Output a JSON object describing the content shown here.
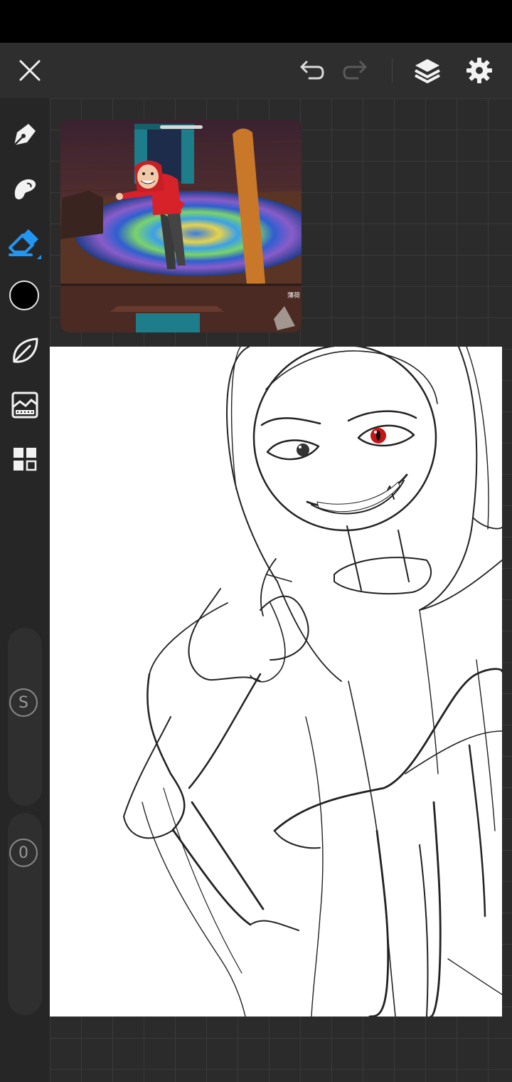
{
  "app": {
    "status_bar_color": "#000000",
    "accent_color": "#2196f3"
  },
  "toolbar": {
    "close_icon": "close-icon",
    "undo_icon": "undo-icon",
    "redo_icon": "redo-icon",
    "layers_icon": "layers-icon",
    "settings_icon": "gear-icon"
  },
  "tools": {
    "items": [
      {
        "name": "brush",
        "icon": "pen-nib-icon"
      },
      {
        "name": "smudge",
        "icon": "smudge-icon"
      },
      {
        "name": "eraser",
        "icon": "eraser-icon",
        "active": true
      },
      {
        "name": "color",
        "icon": "color-swatch",
        "value": "#000000"
      },
      {
        "name": "leaf",
        "icon": "leaf-icon"
      },
      {
        "name": "image-adjust",
        "icon": "image-icon"
      },
      {
        "name": "gallery",
        "icon": "grid-icon"
      }
    ]
  },
  "sliders": {
    "size_label": "S",
    "opacity_label": "0"
  },
  "reference": {
    "caption": "薄荷"
  }
}
